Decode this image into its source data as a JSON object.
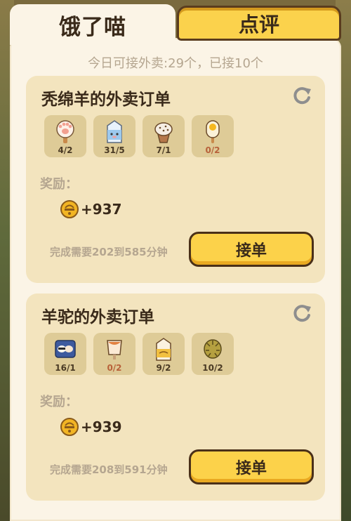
{
  "tabs": {
    "active": "饿了喵",
    "inactive": "点评"
  },
  "summary": "今日可接外卖:29个，已接10个",
  "orders": [
    {
      "title": "秃绵羊的外卖订单",
      "items": [
        {
          "icon": "cat-paw-dessert-icon",
          "count": "4/2"
        },
        {
          "icon": "milk-carton-icon",
          "count": "31/5"
        },
        {
          "icon": "cupcake-icon",
          "count": "7/1"
        },
        {
          "icon": "popsicle-icon",
          "count": "0/2"
        }
      ],
      "reward_label": "奖励：",
      "reward_value": "+937",
      "duration": "完成需要202到585分钟",
      "accept_label": "接单"
    },
    {
      "title": "羊驼的外卖订单",
      "items": [
        {
          "icon": "sushi-plate-icon",
          "count": "16/1"
        },
        {
          "icon": "pudding-icon",
          "count": "0/2"
        },
        {
          "icon": "juice-carton-icon",
          "count": "9/2"
        },
        {
          "icon": "durian-icon",
          "count": "10/2"
        }
      ],
      "reward_label": "奖励：",
      "reward_value": "+939",
      "duration": "完成需要208到591分钟",
      "accept_label": "接单"
    }
  ],
  "colors": {
    "accent": "#fcd24a",
    "card": "#f3e4be",
    "panel": "#fbf4e6",
    "shortage": "#b8623a"
  }
}
